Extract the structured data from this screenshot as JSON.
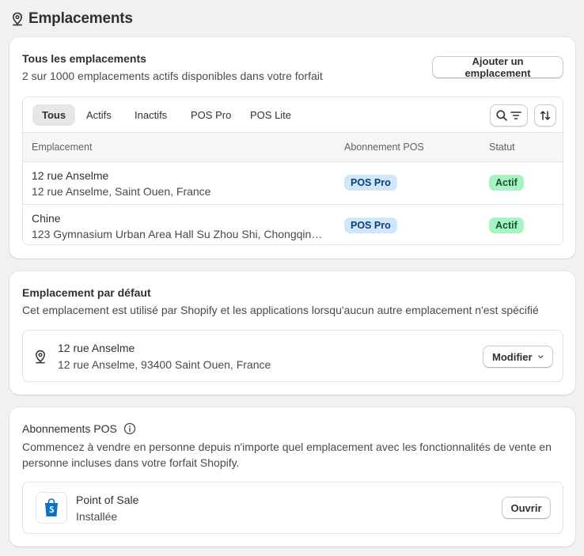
{
  "page": {
    "title": "Emplacements",
    "icon": "location-pin-icon"
  },
  "locations_card": {
    "title": "Tous les emplacements",
    "subtitle": "2 sur 1000 emplacements actifs disponibles dans votre forfait",
    "add_button": "Ajouter un emplacement",
    "tabs": [
      {
        "label": "Tous",
        "active": true
      },
      {
        "label": "Actifs",
        "active": false
      },
      {
        "label": "Inactifs",
        "active": false
      },
      {
        "label": "POS Pro",
        "active": false
      },
      {
        "label": "POS Lite",
        "active": false
      }
    ],
    "columns": [
      "Emplacement",
      "Abonnement POS",
      "Statut"
    ],
    "rows": [
      {
        "name": "12 rue Anselme",
        "address": "12 rue Anselme, Saint Ouen, France",
        "subscription": "POS Pro",
        "status": "Actif"
      },
      {
        "name": "Chine",
        "address": "123 Gymnasium Urban Area Hall Su Zhou Shi, Chongqing,...",
        "subscription": "POS Pro",
        "status": "Actif"
      }
    ]
  },
  "default_card": {
    "title": "Emplacement par défaut",
    "subtitle": "Cet emplacement est utilisé par Shopify et les applications lorsqu'aucun autre emplacement n'est spécifié",
    "location_name": "12 rue Anselme",
    "location_address": "12 rue Anselme, 93400 Saint Ouen, France",
    "modify_button": "Modifier"
  },
  "pos_card": {
    "title": "Abonnements POS",
    "description": "Commencez à vendre en personne depuis n'importe quel emplacement avec les fonctionnalités de vente en personne incluses dans votre forfait Shopify.",
    "app_name": "Point of Sale",
    "app_status": "Installée",
    "open_button": "Ouvrir"
  },
  "colors": {
    "background": "#f1f1f1",
    "pos_badge": "#cfe6fb",
    "active_badge": "#a9f2c4",
    "shopify_green": "#0a72c9"
  }
}
